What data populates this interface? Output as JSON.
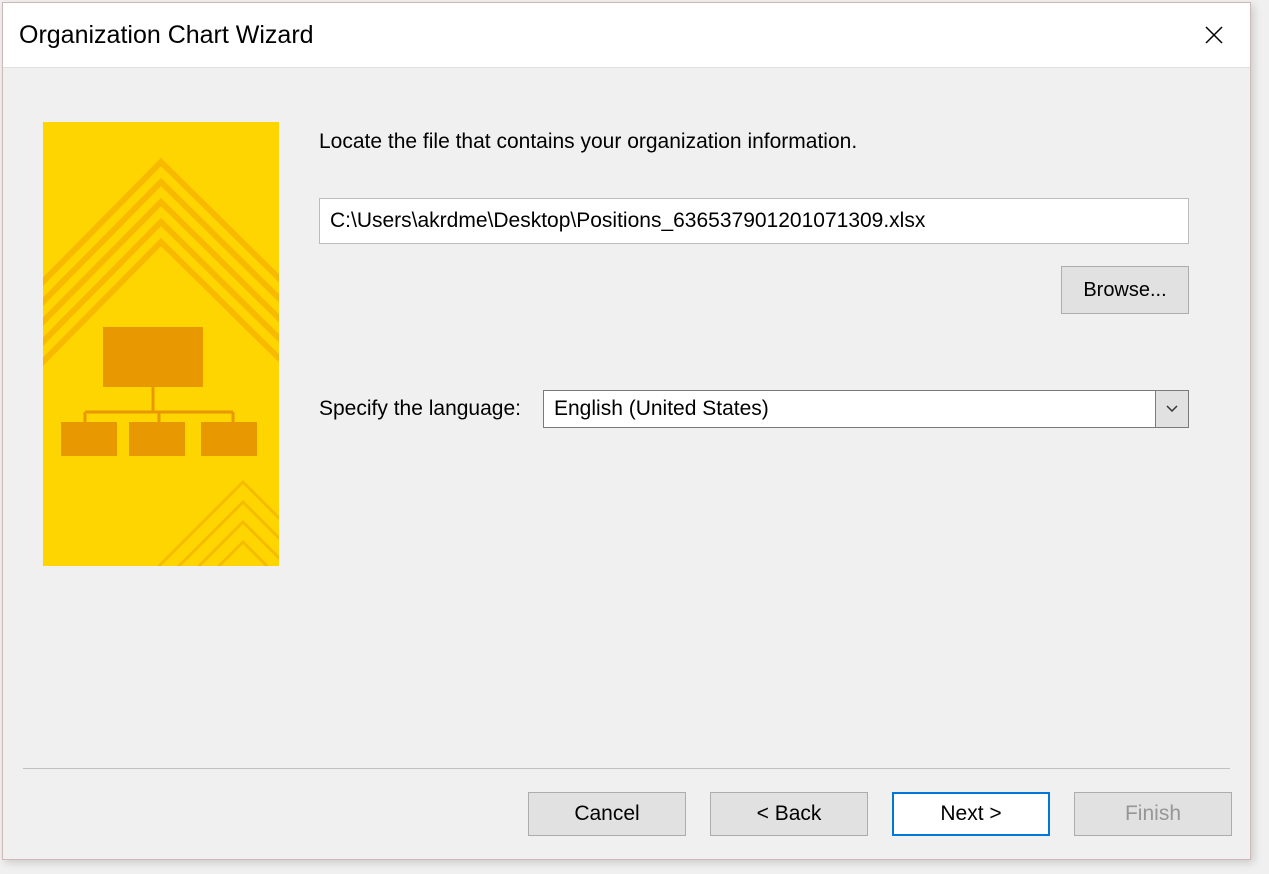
{
  "dialog": {
    "title": "Organization Chart Wizard"
  },
  "content": {
    "instruction": "Locate the file that contains your organization information.",
    "file_path": "C:\\Users\\akrdme\\Desktop\\Positions_636537901201071309.xlsx",
    "browse_label": "Browse...",
    "language_label": "Specify the language:",
    "language_value": "English (United States)"
  },
  "buttons": {
    "cancel": "Cancel",
    "back": "< Back",
    "next": "Next >",
    "finish": "Finish"
  },
  "icons": {
    "close": "close-icon",
    "chevron_down": "chevron-down-icon",
    "wizard_graphic": "org-chart-graphic"
  }
}
